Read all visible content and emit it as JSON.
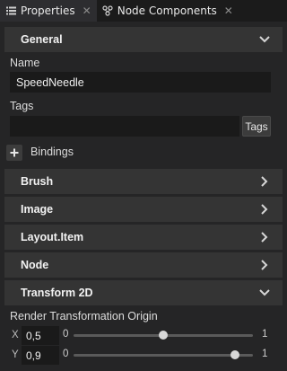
{
  "tabs": [
    {
      "label": "Properties",
      "icon": "list-icon",
      "active": true
    },
    {
      "label": "Node Components",
      "icon": "components-icon",
      "active": false
    }
  ],
  "sections": {
    "general": "General",
    "brush": "Brush",
    "image": "Image",
    "layout_item": "Layout.Item",
    "node": "Node",
    "transform2d": "Transform 2D"
  },
  "name": {
    "label": "Name",
    "value": "SpeedNeedle"
  },
  "tags": {
    "label": "Tags",
    "value": "",
    "button": "Tags"
  },
  "bindings": {
    "label": "Bindings"
  },
  "transform": {
    "origin_label": "Render Transformation Origin",
    "x": {
      "axis": "X",
      "value": "0,5",
      "min": "0",
      "max": "1",
      "fraction": 0.5
    },
    "y": {
      "axis": "Y",
      "value": "0,9",
      "min": "0",
      "max": "1",
      "fraction": 0.9
    }
  },
  "colors": {
    "background": "#252526",
    "section": "#343434",
    "input": "#1a1a1a"
  }
}
